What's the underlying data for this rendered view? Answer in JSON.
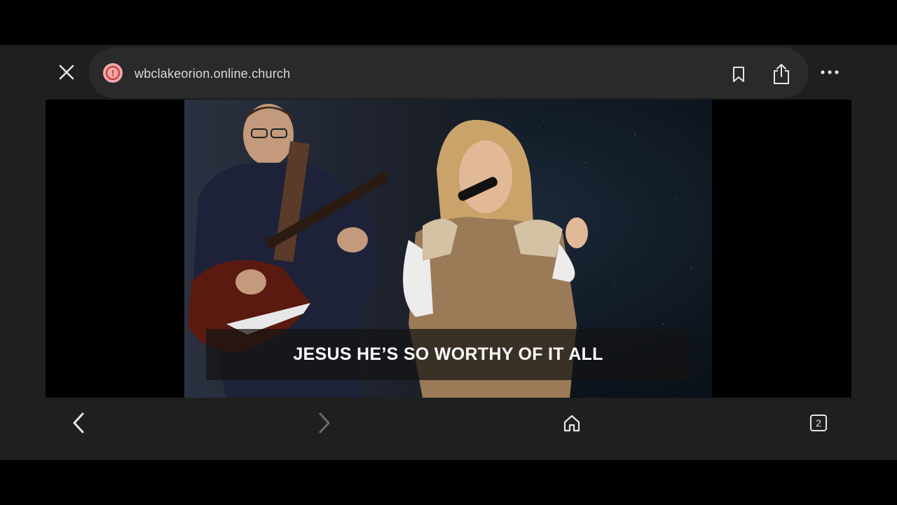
{
  "browser": {
    "url": "wbclakeorion.online.church",
    "site_status_icon": "alert-icon",
    "close_icon": "close-icon",
    "bookmark_icon": "bookmark-icon",
    "share_icon": "share-icon",
    "more_icon": "more-icon"
  },
  "video": {
    "caption": "JESUS HE’S SO WORTHY OF IT ALL"
  },
  "toolbar": {
    "back_icon": "chevron-left-icon",
    "forward_icon": "chevron-right-icon",
    "home_icon": "home-icon",
    "tabs_icon": "tabs-icon",
    "tab_count": "2"
  },
  "colors": {
    "chrome_bg": "#1f1f1f",
    "urlbar_bg": "#2a2a2a",
    "alert_red": "#c0392b"
  }
}
